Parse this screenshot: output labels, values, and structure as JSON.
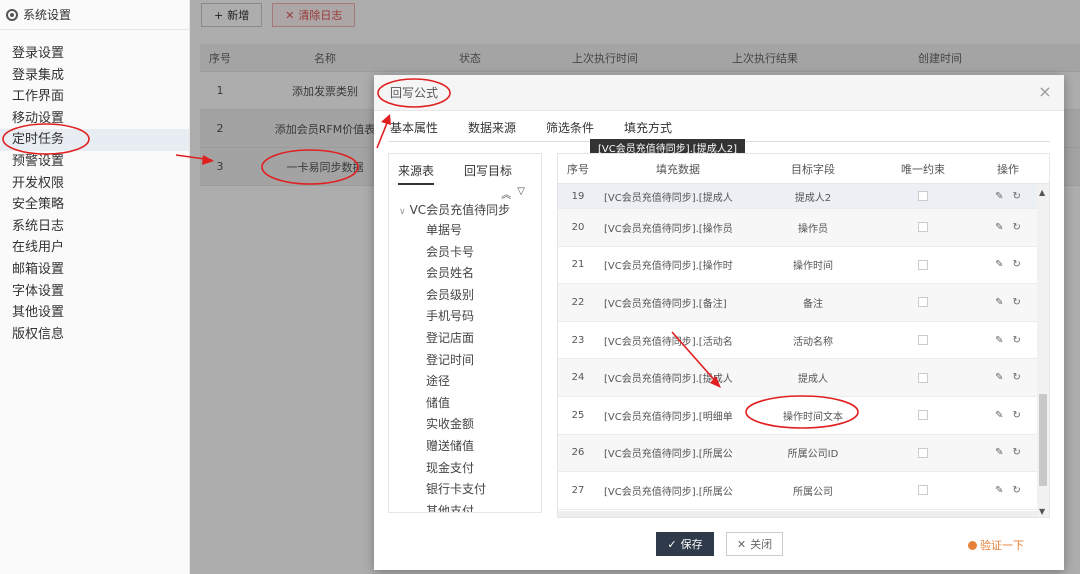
{
  "sidebar": {
    "title": "系统设置",
    "items": [
      "登录设置",
      "登录集成",
      "工作界面",
      "移动设置",
      "定时任务",
      "预警设置",
      "开发权限",
      "安全策略",
      "系统日志",
      "在线用户",
      "邮箱设置",
      "字体设置",
      "其他设置",
      "版权信息"
    ],
    "active_index": 4
  },
  "toolbar": {
    "add_label": "新增",
    "clear_label": "清除日志"
  },
  "bg_table": {
    "headers": [
      "序号",
      "名称",
      "状态",
      "上次执行时间",
      "上次执行结果",
      "创建时间"
    ],
    "rows": [
      [
        "1",
        "添加发票类别",
        "",
        "",
        "",
        ""
      ],
      [
        "2",
        "添加会员RFM价值表",
        "",
        "",
        "",
        ""
      ],
      [
        "3",
        "一卡易同步数据",
        "",
        "",
        "",
        ""
      ]
    ]
  },
  "modal": {
    "title": "回写公式",
    "tabs": [
      "基本属性",
      "数据来源",
      "筛选条件",
      "填充方式"
    ],
    "tooltip": "[VC会员充值待同步].[提成人2]",
    "tree": {
      "tabs": [
        "来源表",
        "回写目标"
      ],
      "root": "VC会员充值待同步",
      "items": [
        "单据号",
        "会员卡号",
        "会员姓名",
        "会员级别",
        "手机号码",
        "登记店面",
        "登记时间",
        "途径",
        "储值",
        "实收金额",
        "赠送储值",
        "现金支付",
        "银行卡支付",
        "其他支付"
      ]
    },
    "grid": {
      "headers": [
        "序号",
        "填充数据",
        "目标字段",
        "唯一约束",
        "操作"
      ],
      "rows": [
        {
          "no": "19",
          "src": "[VC会员充值待同步].[提成人",
          "tgt": "提成人2"
        },
        {
          "no": "20",
          "src": "[VC会员充值待同步].[操作员",
          "tgt": "操作员"
        },
        {
          "no": "21",
          "src": "[VC会员充值待同步].[操作时",
          "tgt": "操作时间"
        },
        {
          "no": "22",
          "src": "[VC会员充值待同步].[备注]",
          "tgt": "备注"
        },
        {
          "no": "23",
          "src": "[VC会员充值待同步].[活动名",
          "tgt": "活动名称"
        },
        {
          "no": "24",
          "src": "[VC会员充值待同步].[提成人",
          "tgt": "提成人"
        },
        {
          "no": "25",
          "src": "[VC会员充值待同步].[明细单",
          "tgt": "操作时间文本"
        },
        {
          "no": "26",
          "src": "[VC会员充值待同步].[所属公",
          "tgt": "所属公司ID"
        },
        {
          "no": "27",
          "src": "[VC会员充值待同步].[所属公",
          "tgt": "所属公司"
        }
      ]
    },
    "save_label": "保存",
    "close_label": "关闭",
    "verify_label": "验证一下"
  },
  "colors": {
    "annotation": "#e02020",
    "primary_btn": "#2f3a4a",
    "verify": "#e8823a"
  }
}
